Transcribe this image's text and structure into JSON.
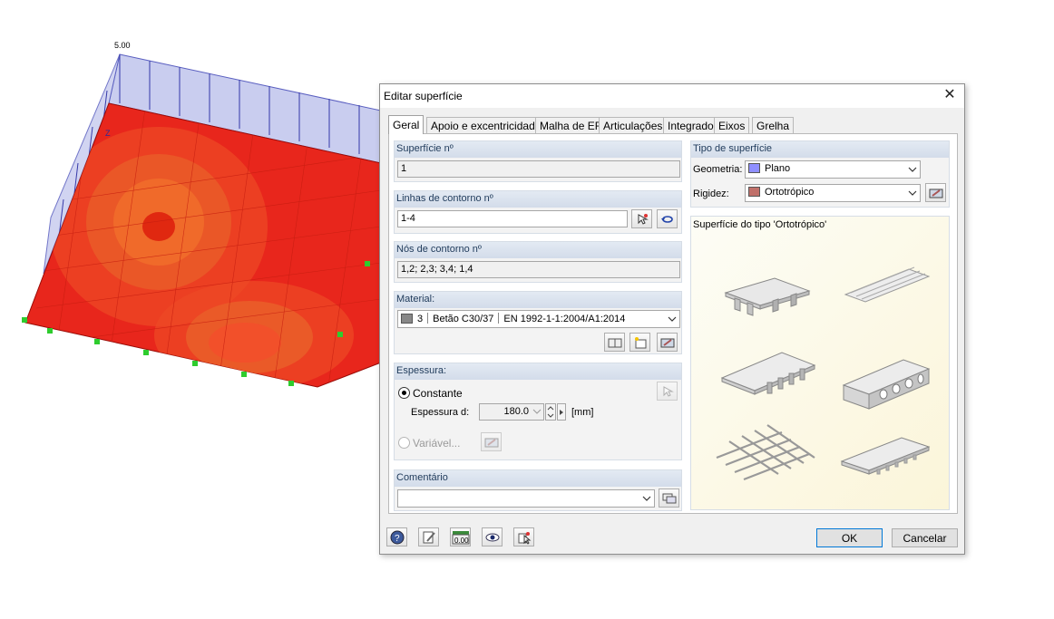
{
  "viewport": {
    "load_label": "5.00",
    "axis_label": "Z"
  },
  "dialog": {
    "title": "Editar superfície",
    "tabs": [
      {
        "label": "Geral"
      },
      {
        "label": "Apoio e excentricidade"
      },
      {
        "label": "Malha de EF"
      },
      {
        "label": "Articulações"
      },
      {
        "label": "Integrado"
      },
      {
        "label": "Eixos"
      },
      {
        "label": "Grelha"
      }
    ],
    "surface_no": {
      "label": "Superfície nº",
      "value": "1"
    },
    "boundary_lines": {
      "label": "Linhas de contorno nº",
      "value": "1-4"
    },
    "boundary_nodes": {
      "label": "Nós de contorno nº",
      "value": "1,2; 2,3; 3,4; 1,4"
    },
    "material": {
      "label": "Material:",
      "number": "3",
      "name": "Betão C30/37",
      "standard": "EN 1992-1-1:2004/A1:2014"
    },
    "thickness": {
      "label": "Espessura:",
      "constant_label": "Constante",
      "thickness_label": "Espessura d:",
      "value": "180.0",
      "unit": "[mm]",
      "variable_label": "Variável..."
    },
    "comment": {
      "label": "Comentário",
      "value": ""
    },
    "surface_type": {
      "label": "Tipo de superfície",
      "geometry_label": "Geometria:",
      "geometry_value": "Plano",
      "geometry_color": "#8f8fff",
      "stiffness_label": "Rigidez:",
      "stiffness_value": "Ortotrópico",
      "stiffness_color": "#c0706a"
    },
    "preview_title": "Superfície do tipo 'Ortotrópico'",
    "ok_label": "OK",
    "cancel_label": "Cancelar",
    "footer_icons": [
      "help-icon",
      "edit-icon",
      "decimal-icon",
      "view-icon",
      "select-icon"
    ]
  }
}
